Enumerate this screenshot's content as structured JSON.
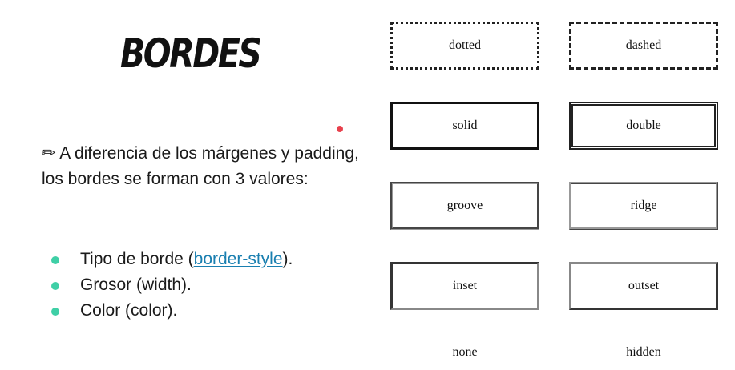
{
  "title": "BORDES",
  "intro": "✏ A diferencia de los márgenes y padding, los bordes se forman con 3 valores:",
  "bullets": [
    {
      "before": "Tipo de borde (",
      "link": "border-style",
      "after": ")."
    },
    {
      "text": "Grosor (width)."
    },
    {
      "text": "Color (color)."
    }
  ],
  "border_examples": [
    "dotted",
    "dashed",
    "solid",
    "double",
    "groove",
    "ridge",
    "inset",
    "outset",
    "none",
    "hidden"
  ],
  "colors": {
    "accent_dot": "#e8414d",
    "bullet": "#3fcfa6",
    "link": "#1a7fb0"
  }
}
